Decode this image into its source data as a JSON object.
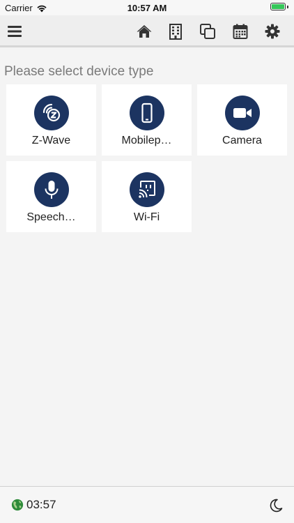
{
  "status_bar": {
    "carrier": "Carrier",
    "time": "10:57 AM",
    "battery_level": 1.0
  },
  "toolbar": {
    "icons": [
      "menu-icon",
      "home-icon",
      "building-icon",
      "windows-icon",
      "calendar-icon",
      "settings-icon"
    ]
  },
  "main": {
    "heading": "Please select device type",
    "devices": [
      {
        "label": "Z-Wave",
        "icon": "zwave-icon"
      },
      {
        "label": "Mobilep…",
        "icon": "mobile-phone-icon"
      },
      {
        "label": "Camera",
        "icon": "camera-icon"
      },
      {
        "label": "Speech…",
        "icon": "microphone-icon"
      },
      {
        "label": "Wi-Fi",
        "icon": "wifi-plug-icon"
      }
    ]
  },
  "footer": {
    "time": "03:57",
    "icons": [
      "globe-icon",
      "moon-icon"
    ]
  },
  "colors": {
    "accent": "#1c3461",
    "toolbar_icon": "#333333",
    "heading": "#7a7a7a",
    "battery": "#34c759",
    "globe": "#2e8b3a"
  }
}
